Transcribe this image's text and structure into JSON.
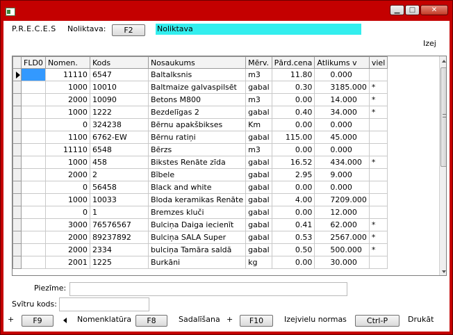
{
  "window": {
    "buttons": {
      "minimize": "▁",
      "maximize": "□",
      "close": "✕"
    }
  },
  "header": {
    "app_label": "P.R.E.C.E.S",
    "field_label": "Noliktava:",
    "f2_label": "F2",
    "field_value": "Noliktava",
    "right_label": "Izej"
  },
  "table": {
    "columns": [
      "FLD0",
      "Nomen.",
      "Kods",
      "Nosaukums",
      "Mērv.",
      "Pārd.cena",
      "Atlikums   v",
      "viel"
    ],
    "rows": [
      [
        "",
        "11110",
        "6547",
        "Baltalksnis",
        "m3",
        "11.80",
        "0.000",
        ""
      ],
      [
        "",
        "1000",
        "10010",
        "Baltmaize galvaspilsēt",
        "gabal",
        "0.30",
        "3185.000",
        "*"
      ],
      [
        "",
        "2000",
        "10090",
        "Betons M800",
        "m3",
        "0.00",
        "14.000",
        "*"
      ],
      [
        "",
        "1000",
        "1222",
        "Bezdelīgas 2",
        "gabal",
        "0.40",
        "34.000",
        "*"
      ],
      [
        "",
        "0",
        "324238",
        "Bērnu apakšbikses",
        "Km",
        "0.00",
        "0.000",
        ""
      ],
      [
        "",
        "1100",
        "6762-EW",
        "Bērnu ratiņi",
        "gabal",
        "115.00",
        "45.000",
        ""
      ],
      [
        "",
        "11110",
        "6548",
        "Bērzs",
        "m3",
        "0.00",
        "0.000",
        ""
      ],
      [
        "",
        "1000",
        "458",
        "Bikstes Renāte zīda",
        "gabal",
        "16.52",
        "434.000",
        "*"
      ],
      [
        "",
        "2000",
        "2",
        "Bībele",
        "gabal",
        "2.95",
        "9.000",
        ""
      ],
      [
        "",
        "0",
        "56458",
        "Black and white",
        "gabal",
        "0.00",
        "0.000",
        ""
      ],
      [
        "",
        "1000",
        "10033",
        "Bloda keramikas Renāte",
        "gabal",
        "4.00",
        "7209.000",
        ""
      ],
      [
        "",
        "0",
        "1",
        "Bremzes kluči",
        "gabal",
        "0.00",
        "12.000",
        ""
      ],
      [
        "",
        "3000",
        "76576567",
        "Bulciņa Daiga iecienīt",
        "gabal",
        "0.41",
        "62.000",
        "*"
      ],
      [
        "",
        "2000",
        "89237892",
        "Bulciņa SALA Super",
        "gabal",
        "0.53",
        "2567.000",
        "*"
      ],
      [
        "",
        "2000",
        "2334",
        "bulciņa Tamāra saldā",
        "gabal",
        "0.50",
        "500.000",
        "*"
      ],
      [
        "",
        "2001",
        "1225",
        "Burkāni",
        "kg",
        "0.00",
        "30.000",
        ""
      ]
    ]
  },
  "footer": {
    "piezime_label": "Piezīme:",
    "piezime_value": "",
    "barcode_label": "Svītru kods:",
    "barcode_value": "",
    "plus1": "+",
    "f9_label": "F9",
    "nomenklatura_label": "Nomenklatūra",
    "f8_label": "F8",
    "sadalisana_label": "Sadalīšana",
    "plus2": "+",
    "f10_label": "F10",
    "izejvielu_label": "Izejvielu normas",
    "ctrlp_label": "Ctrl-P",
    "drukat_label": "Drukāt"
  }
}
